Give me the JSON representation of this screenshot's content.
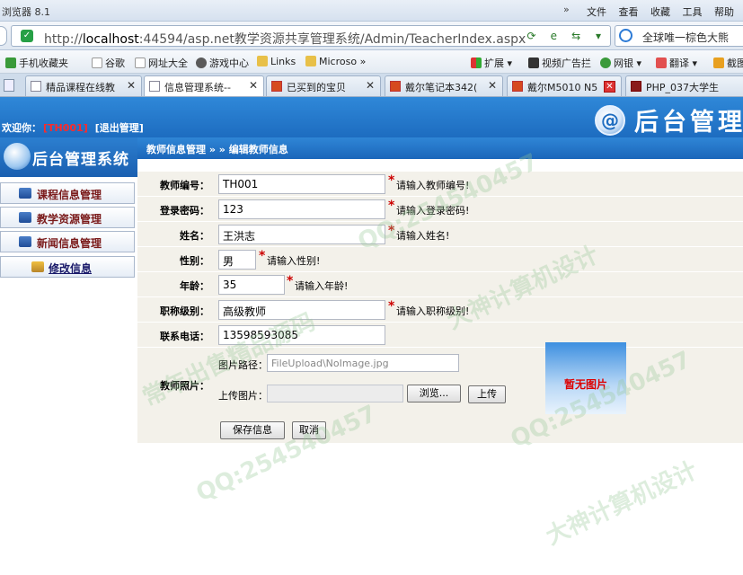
{
  "browser": {
    "title": "浏览器 8.1",
    "menus": [
      "文件",
      "查看",
      "收藏",
      "工具",
      "帮助"
    ],
    "url_prefix": "http://",
    "url_host": "localhost",
    "url_rest": ":44594/asp.net教学资源共享管理系统/Admin/TeacherIndex.aspx",
    "search_text": "全球唯一棕色大熊",
    "favorites": [
      "手机收藏夹",
      "谷歌",
      "网址大全",
      "游戏中心",
      "Links",
      "Microso",
      "扩展",
      "视频广告拦",
      "网银",
      "翻译",
      "截图"
    ],
    "tabs": [
      {
        "label": "精品课程在线教"
      },
      {
        "label": "信息管理系统--"
      },
      {
        "label": "已买到的宝贝"
      },
      {
        "label": "戴尔笔记本342("
      },
      {
        "label": "戴尔M5010 N5"
      },
      {
        "label": "PHP_037大学生"
      }
    ]
  },
  "header": {
    "welcome_label": "欢迎你：",
    "user_id": "[TH001]",
    "logout_label": "[退出管理]",
    "brand_text": "后台管理"
  },
  "sidebar": {
    "title": "后台管理系统",
    "items": [
      {
        "label": "课程信息管理"
      },
      {
        "label": "教学资源管理"
      },
      {
        "label": "新闻信息管理"
      }
    ],
    "sub_item": {
      "label": "修改信息"
    }
  },
  "breadcrumb": "教师信息管理 » » 编辑教师信息",
  "form": {
    "teacher_no": {
      "label": "教师编号：",
      "value": "TH001",
      "hint": "请输入教师编号!"
    },
    "password": {
      "label": "登录密码：",
      "value": "123",
      "hint": "请输入登录密码!"
    },
    "name": {
      "label": "姓名：",
      "value": "王洪志",
      "hint": "请输入姓名!"
    },
    "gender": {
      "label": "性别：",
      "value": "男",
      "hint": "请输入性别!"
    },
    "age": {
      "label": "年龄：",
      "value": "35",
      "hint": "请输入年龄!"
    },
    "title": {
      "label": "职称级别：",
      "value": "高级教师",
      "hint": "请输入职称级别!"
    },
    "phone": {
      "label": "联系电话：",
      "value": "13598593085"
    },
    "photo": {
      "label": "教师照片：",
      "path_label": "图片路径：",
      "path_value": "FileUpload\\NoImage.jpg",
      "upload_label": "上传图片：",
      "browse_label": "浏览...",
      "upload_button": "上传",
      "no_image_text": "暂无图片"
    },
    "save_button": "保存信息",
    "cancel_button": "取消"
  },
  "watermark": {
    "qq": "QQ:254540457",
    "designer": "大神计算机设计",
    "shop": "常年出售精品源码"
  }
}
